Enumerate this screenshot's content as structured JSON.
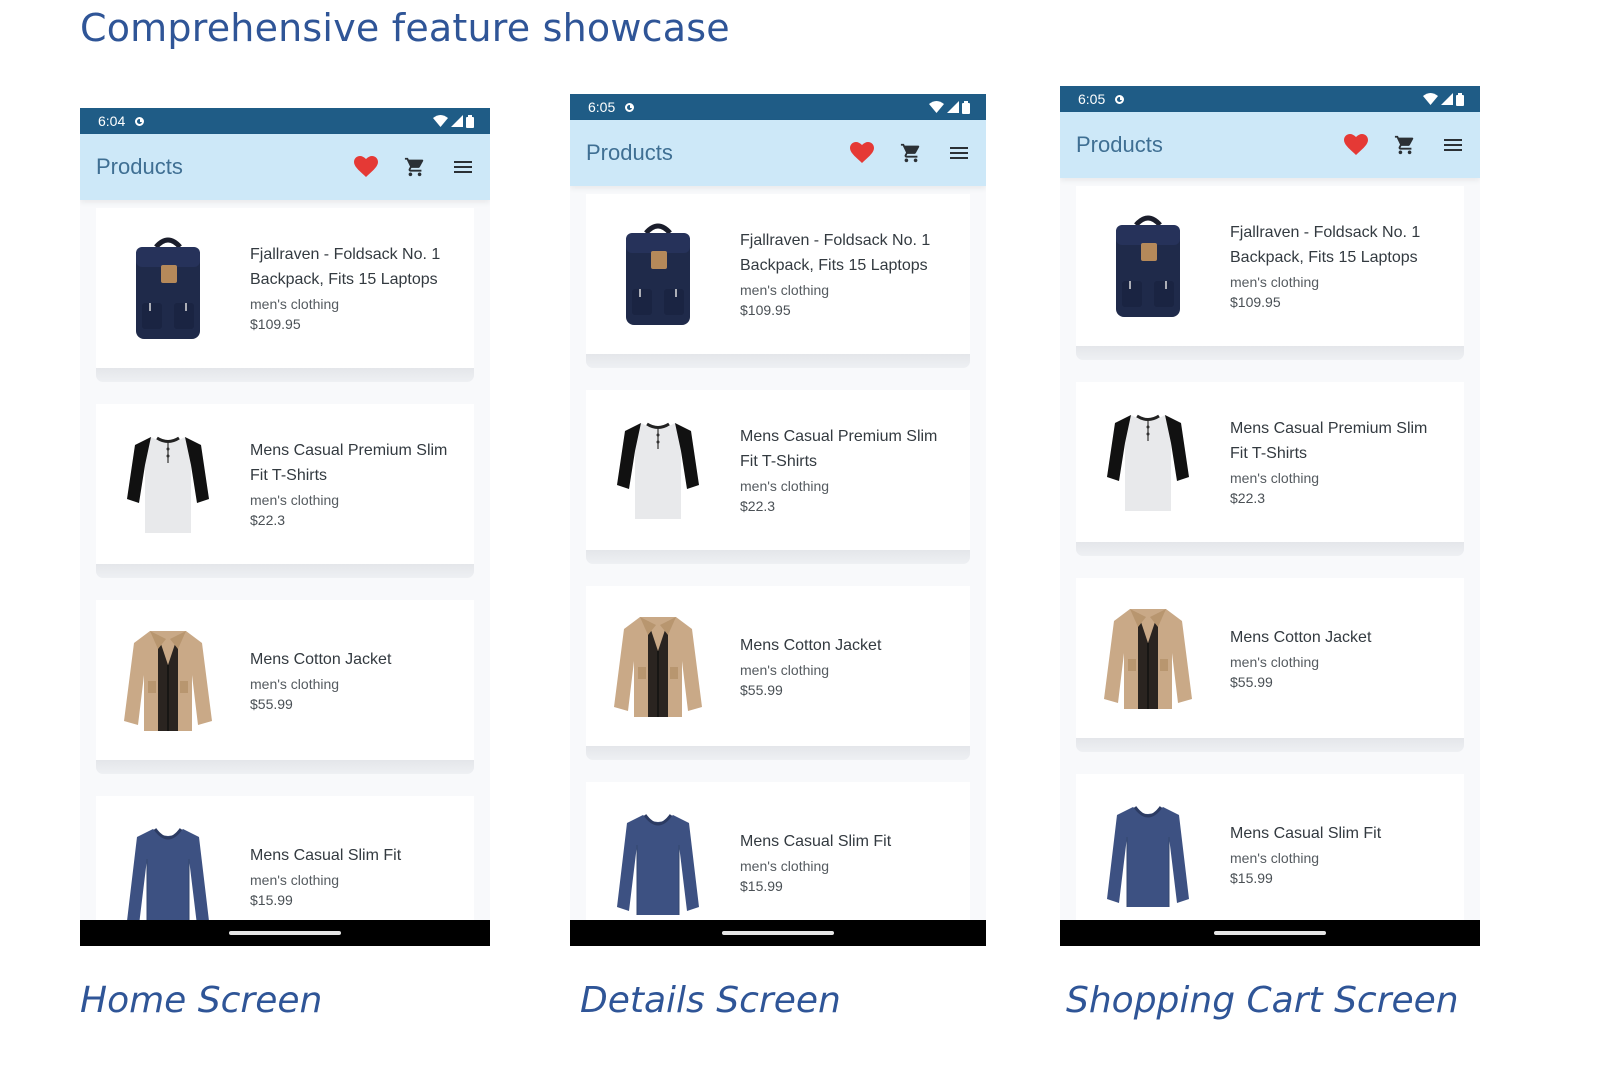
{
  "page_title": "Comprehensive feature showcase",
  "colors": {
    "title_blue": "#2f5597",
    "status_bar": "#1f5c86",
    "app_bar": "#cde8f8",
    "heart": "#e53935"
  },
  "screens": [
    {
      "caption": "Home Screen",
      "status_time": "6:04",
      "app_title": "Products",
      "icons": [
        "favorite-heart-icon",
        "shopping-cart-icon",
        "menu-icon"
      ],
      "products": [
        {
          "title_lines": [
            "Fjallraven - Foldsack No. 1",
            "Backpack, Fits 15 Laptops"
          ],
          "category": "men's clothing",
          "price": "$109.95",
          "image": "backpack"
        },
        {
          "title_lines": [
            "Mens Casual Premium Slim",
            "Fit T-Shirts"
          ],
          "category": "men's clothing",
          "price": "$22.3",
          "image": "tshirt"
        },
        {
          "title_lines": [
            "Mens Cotton Jacket"
          ],
          "category": "men's clothing",
          "price": "$55.99",
          "image": "jacket"
        },
        {
          "title_lines": [
            "Mens Casual Slim Fit"
          ],
          "category": "men's clothing",
          "price": "$15.99",
          "image": "longsleeve"
        }
      ]
    },
    {
      "caption": "Details Screen",
      "status_time": "6:05",
      "app_title": "Products",
      "icons": [
        "favorite-heart-icon",
        "shopping-cart-icon",
        "menu-icon"
      ],
      "products": [
        {
          "title_lines": [
            "Fjallraven - Foldsack No. 1",
            "Backpack, Fits 15 Laptops"
          ],
          "category": "men's clothing",
          "price": "$109.95",
          "image": "backpack"
        },
        {
          "title_lines": [
            "Mens Casual Premium Slim",
            "Fit T-Shirts"
          ],
          "category": "men's clothing",
          "price": "$22.3",
          "image": "tshirt"
        },
        {
          "title_lines": [
            "Mens Cotton Jacket"
          ],
          "category": "men's clothing",
          "price": "$55.99",
          "image": "jacket"
        },
        {
          "title_lines": [
            "Mens Casual Slim Fit"
          ],
          "category": "men's clothing",
          "price": "$15.99",
          "image": "longsleeve"
        }
      ]
    },
    {
      "caption": "Shopping Cart Screen",
      "status_time": "6:05",
      "app_title": "Products",
      "icons": [
        "favorite-heart-icon",
        "shopping-cart-icon",
        "menu-icon"
      ],
      "products": [
        {
          "title_lines": [
            "Fjallraven - Foldsack No. 1",
            "Backpack, Fits 15 Laptops"
          ],
          "category": "men's clothing",
          "price": "$109.95",
          "image": "backpack"
        },
        {
          "title_lines": [
            "Mens Casual Premium Slim",
            "Fit T-Shirts"
          ],
          "category": "men's clothing",
          "price": "$22.3",
          "image": "tshirt"
        },
        {
          "title_lines": [
            "Mens Cotton Jacket"
          ],
          "category": "men's clothing",
          "price": "$55.99",
          "image": "jacket"
        },
        {
          "title_lines": [
            "Mens Casual Slim Fit"
          ],
          "category": "men's clothing",
          "price": "$15.99",
          "image": "longsleeve"
        }
      ]
    }
  ]
}
